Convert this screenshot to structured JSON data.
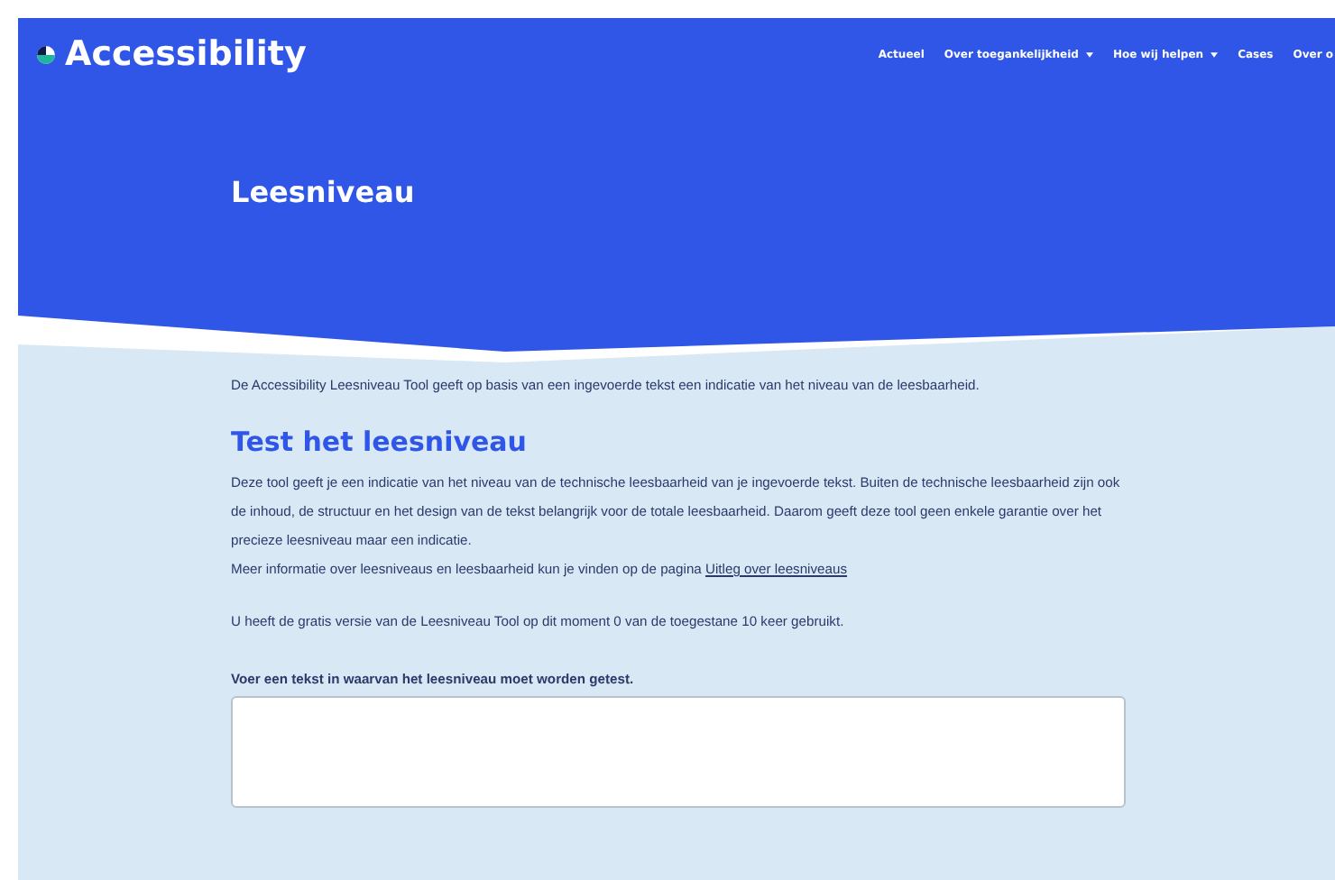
{
  "header": {
    "logo_text": "Accessibility",
    "nav": [
      {
        "label": "Actueel",
        "dropdown": false
      },
      {
        "label": "Over toegankelijkheid",
        "dropdown": true
      },
      {
        "label": "Hoe wij helpen",
        "dropdown": true
      },
      {
        "label": "Cases",
        "dropdown": false
      },
      {
        "label": "Over o",
        "dropdown": false
      }
    ],
    "title": "Leesniveau"
  },
  "content": {
    "intro": "De Accessibility Leesniveau Tool geeft op basis van een ingevoerde tekst een indicatie van het niveau van de leesbaarheid.",
    "heading": "Test het leesniveau",
    "description": "Deze tool geeft je een indicatie van het niveau van de technische leesbaarheid van je ingevoerde tekst. Buiten de technische leesbaarheid zijn ook de inhoud, de structuur en het design van de tekst belangrijk voor de totale leesbaarheid. Daarom geeft deze tool geen enkele garantie over het precieze leesniveau maar een indicatie.",
    "more_info": "Meer informatie over leesniveaus en leesbaarheid kun je vinden op de pagina ",
    "more_info_link": "Uitleg over leesniveaus",
    "usage": "U heeft de gratis versie van de Leesniveau Tool op dit moment 0 van de toegestane 10 keer gebruikt.",
    "field_label": "Voer een tekst in waarvan het leesniveau moet worden getest."
  }
}
